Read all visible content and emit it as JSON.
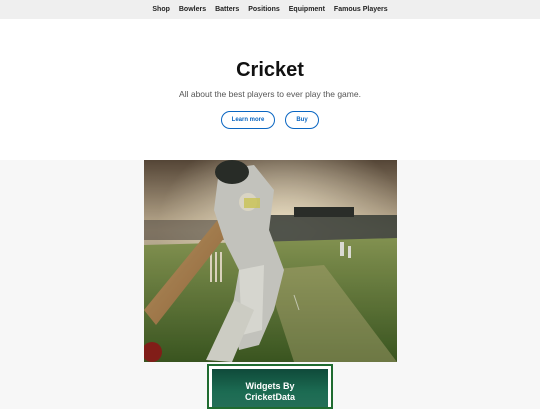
{
  "nav": {
    "items": [
      "Shop",
      "Bowlers",
      "Batters",
      "Positions",
      "Equipment",
      "Famous Players"
    ]
  },
  "hero": {
    "title": "Cricket",
    "subtitle": "All about the best players to ever play the game.",
    "learn_more_label": "Learn more",
    "buy_label": "Buy"
  },
  "widget": {
    "line1": "Widgets By",
    "line2": "CricketData"
  },
  "colors": {
    "accent": "#0a66c2",
    "nav_bg": "#efefef",
    "widget_border": "#1f6b30"
  }
}
